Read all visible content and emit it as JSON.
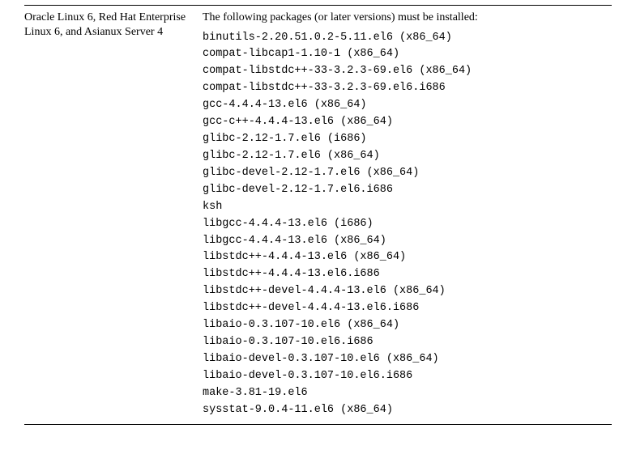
{
  "os_label": "Oracle Linux 6, Red Hat Enterprise Linux 6, and Asianux Server 4",
  "intro": "The following packages (or later versions) must be installed:",
  "packages": [
    "binutils-2.20.51.0.2-5.11.el6 (x86_64)",
    "compat-libcap1-1.10-1 (x86_64)",
    "compat-libstdc++-33-3.2.3-69.el6 (x86_64)",
    "compat-libstdc++-33-3.2.3-69.el6.i686",
    "gcc-4.4.4-13.el6 (x86_64)",
    "gcc-c++-4.4.4-13.el6 (x86_64)",
    "glibc-2.12-1.7.el6 (i686)",
    "glibc-2.12-1.7.el6 (x86_64)",
    "glibc-devel-2.12-1.7.el6 (x86_64)",
    "glibc-devel-2.12-1.7.el6.i686",
    "ksh",
    "libgcc-4.4.4-13.el6 (i686)",
    "libgcc-4.4.4-13.el6 (x86_64)",
    "libstdc++-4.4.4-13.el6 (x86_64)",
    "libstdc++-4.4.4-13.el6.i686",
    "libstdc++-devel-4.4.4-13.el6 (x86_64)",
    "libstdc++-devel-4.4.4-13.el6.i686",
    "libaio-0.3.107-10.el6 (x86_64)",
    "libaio-0.3.107-10.el6.i686",
    "libaio-devel-0.3.107-10.el6 (x86_64)",
    "libaio-devel-0.3.107-10.el6.i686",
    "make-3.81-19.el6",
    "sysstat-9.0.4-11.el6 (x86_64)"
  ]
}
